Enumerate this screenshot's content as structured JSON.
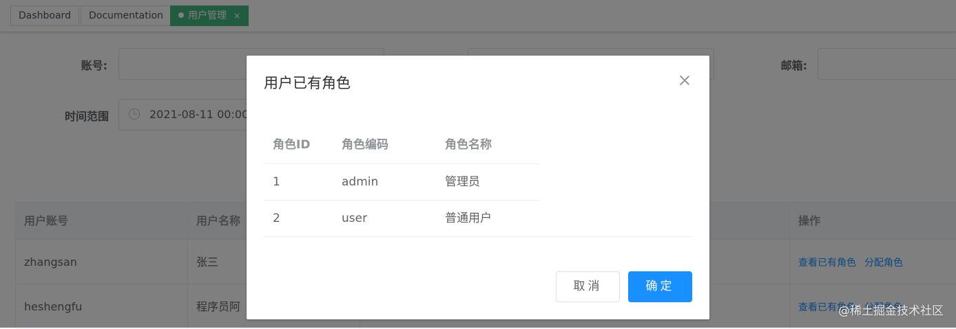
{
  "tags": [
    {
      "label": "Dashboard"
    },
    {
      "label": "Documentation"
    },
    {
      "label": "用户管理",
      "close": "×",
      "active": true
    }
  ],
  "form": {
    "account_label": "账号:",
    "email_label": "邮箱:",
    "time_range_label": "时间范围",
    "time_range_value": "2021-08-11 00:00"
  },
  "table": {
    "headers": [
      "用户账号",
      "用户名称",
      "操作"
    ],
    "rows": [
      {
        "account": "zhangsan",
        "name": "张三",
        "view_roles": "查看已有角色",
        "assign_role": "分配角色"
      },
      {
        "account": "heshengfu",
        "name": "程序员阿",
        "view_roles": "查看已有角色",
        "assign_role": "分配角色"
      }
    ]
  },
  "watermark": "@稀土掘金技术社区",
  "dialog": {
    "title": "用户已有角色",
    "columns": [
      "角色ID",
      "角色编码",
      "角色名称"
    ],
    "roles": [
      {
        "id": "1",
        "code": "admin",
        "name": "管理员"
      },
      {
        "id": "2",
        "code": "user",
        "name": "普通用户"
      }
    ],
    "cancel_label": "取消",
    "confirm_label": "确定"
  },
  "colors": {
    "active_tag": "#42b983",
    "primary": "#1890ff",
    "overlay": "rgba(0,0,0,0.5)"
  }
}
